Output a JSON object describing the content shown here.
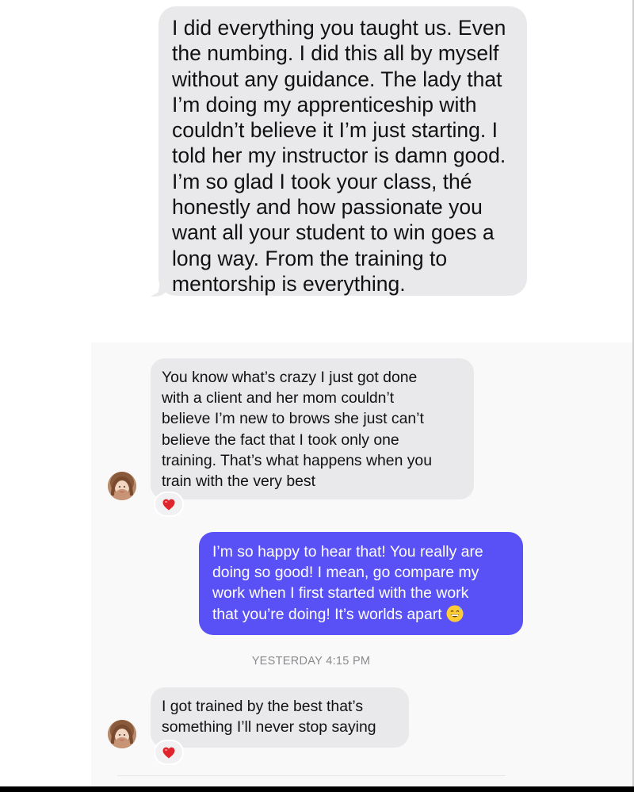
{
  "messages": {
    "outgoing_top": {
      "lines": [
        "I did everything you taught us. Even",
        "the numbing. I did this all by myself",
        "without any guidance. The lady that",
        "I’m doing my apprenticeship with",
        "couldn’t believe it I’m just starting. I",
        "told her my instructor is damn good.",
        "I’m so glad I took your class, thé",
        "honestly and how passionate you",
        "want all your student to win goes a",
        "long way. From the training to",
        "mentorship is everything."
      ]
    },
    "incoming_1": {
      "lines": [
        "You know what’s crazy I just got done",
        "with a client and her mom couldn’t",
        "believe I’m new to brows she just can’t",
        "believe the fact that I took only one",
        "training. That’s what happens when you",
        "train with the very best"
      ],
      "reaction": "heart-icon"
    },
    "outgoing_reply": {
      "lines": [
        "I’m so happy to hear that! You really are",
        "doing so good! I mean, go compare my",
        "work when I first started with the work",
        "that you’re doing! It’s worlds apart"
      ],
      "emoji": "grinning-sweat-emoji"
    },
    "timestamp": "YESTERDAY 4:15 PM",
    "incoming_2": {
      "lines": [
        "I got trained by the best that’s",
        "something I’ll never stop saying"
      ],
      "reaction": "heart-icon"
    }
  },
  "colors": {
    "gray_bubble": "#e9e9eb",
    "purple_bubble": "#5951f5",
    "heart": "#e0242c",
    "timestamp": "#8a8a8e"
  }
}
